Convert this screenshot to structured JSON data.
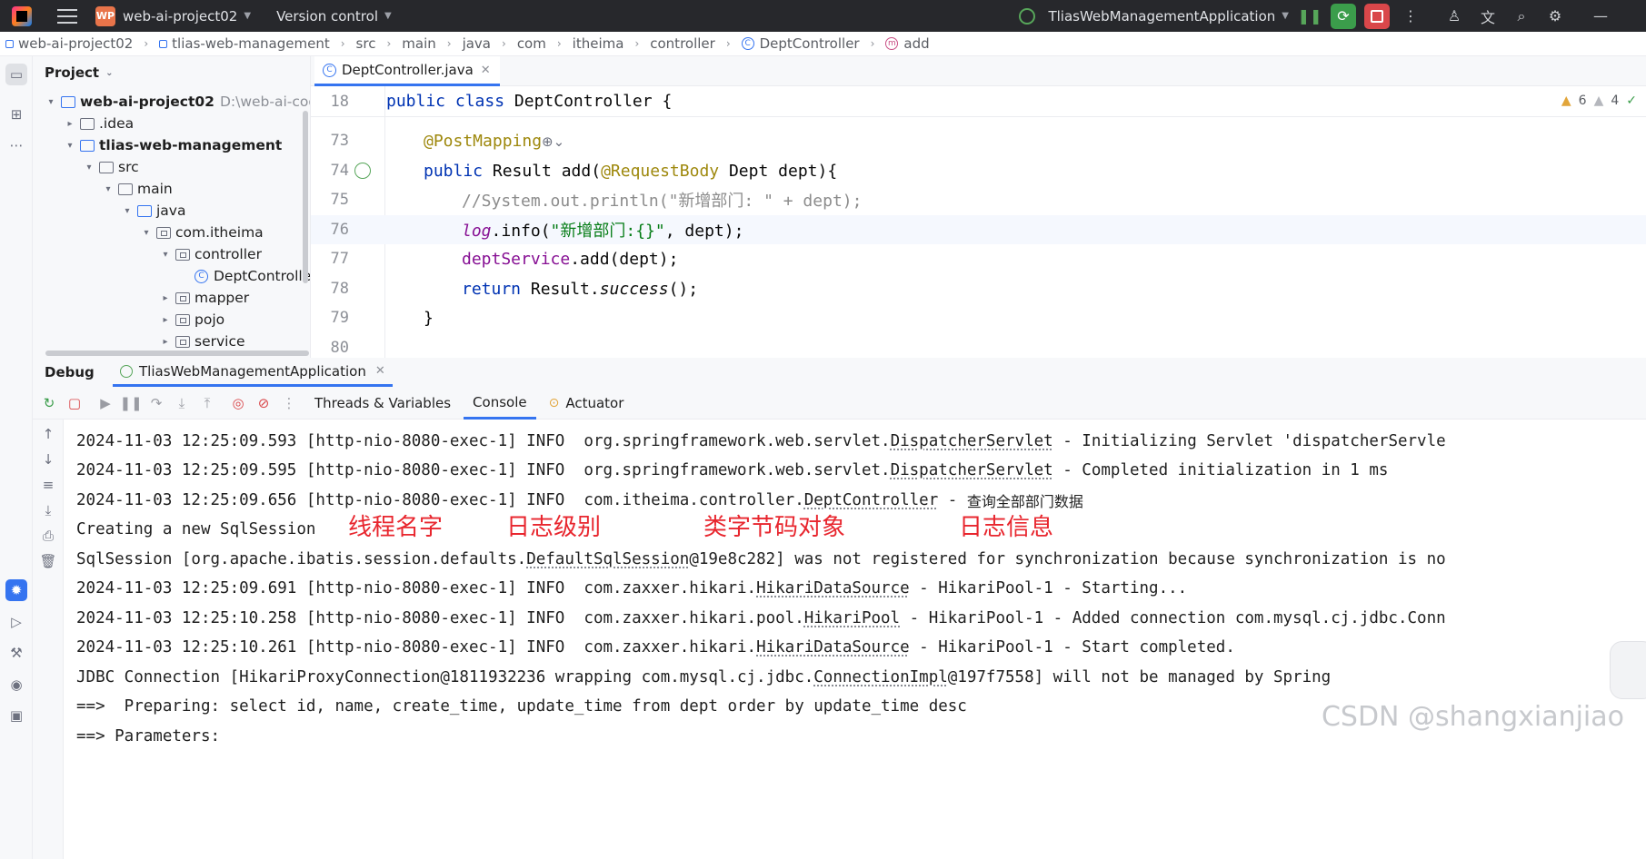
{
  "titlebar": {
    "project_badge": "WP",
    "project_name": "web-ai-project02",
    "vcs_label": "Version control",
    "run_config": "TliasWebManagementApplication"
  },
  "breadcrumb": [
    "web-ai-project02",
    "tlias-web-management",
    "src",
    "main",
    "java",
    "com",
    "itheima",
    "controller",
    "DeptController",
    "add"
  ],
  "project_panel": {
    "title": "Project",
    "tree": [
      {
        "label": "web-ai-project02",
        "path": "D:\\web-ai-code\\w"
      },
      {
        "label": ".idea"
      },
      {
        "label": "tlias-web-management"
      },
      {
        "label": "src"
      },
      {
        "label": "main"
      },
      {
        "label": "java"
      },
      {
        "label": "com.itheima"
      },
      {
        "label": "controller"
      },
      {
        "label": "DeptController"
      },
      {
        "label": "mapper"
      },
      {
        "label": "pojo"
      },
      {
        "label": "service"
      }
    ]
  },
  "editor": {
    "tab": "DeptController.java",
    "warnings": "6",
    "weak_warnings": "4",
    "lines": [
      {
        "n": "18",
        "kw": "public class ",
        "rest": "DeptController {"
      },
      {
        "n": "73",
        "ann": "@PostMapping"
      },
      {
        "n": "74",
        "kw": "public ",
        "t1": "Result ",
        "t2": "add(",
        "ann": "@RequestBody",
        "t3": " Dept dept){"
      },
      {
        "n": "75",
        "cmt": "//System.out.println(\"新增部门: \" + dept);"
      },
      {
        "n": "76",
        "fld": "log",
        "t1": ".info(",
        "str": "\"新增部门:{}\"",
        "t2": ", dept);"
      },
      {
        "n": "77",
        "fld": "deptService",
        "t1": ".add(dept);"
      },
      {
        "n": "78",
        "kw": "return ",
        "t1": "Result.",
        "it": "success",
        "t2": "();"
      },
      {
        "n": "79",
        "t1": "}"
      },
      {
        "n": "80",
        "t1": ""
      }
    ]
  },
  "debug": {
    "title": "Debug",
    "session_tab": "TliasWebManagementApplication",
    "tabs": [
      "Threads & Variables",
      "Console",
      "Actuator"
    ]
  },
  "console": {
    "lines": [
      {
        "a": "2024-11-03 12:25:09.593 [http-nio-8080-exec-1] INFO  org.springframework.web.servlet.",
        "u": "DispatcherServlet",
        "b": " - Initializing Servlet 'dispatcherServle"
      },
      {
        "a": "2024-11-03 12:25:09.595 [http-nio-8080-exec-1] INFO  org.springframework.web.servlet.",
        "u": "DispatcherServlet",
        "b": " - Completed initialization in 1 ms"
      },
      {
        "a": "2024-11-03 12:25:09.656 [http-nio-8080-exec-1] INFO  com.itheima.controller.",
        "u": "DeptController",
        "b": " - ",
        "cjk": "查询全部部门数据"
      },
      {
        "a": "Creating a new SqlSession",
        "u": "",
        "b": ""
      },
      {
        "a": "SqlSession [org.apache.ibatis.session.defaults.",
        "u": "DefaultSqlSession",
        "b": "@19e8c282] was not registered for synchronization because synchronization is no"
      },
      {
        "a": "2024-11-03 12:25:09.691 [http-nio-8080-exec-1] INFO  com.zaxxer.hikari.",
        "u": "HikariDataSource",
        "b": " - HikariPool-1 - Starting..."
      },
      {
        "a": "2024-11-03 12:25:10.258 [http-nio-8080-exec-1] INFO  com.zaxxer.hikari.pool.",
        "u": "HikariPool",
        "b": " - HikariPool-1 - Added connection com.mysql.cj.jdbc.Conn"
      },
      {
        "a": "2024-11-03 12:25:10.261 [http-nio-8080-exec-1] INFO  com.zaxxer.hikari.",
        "u": "HikariDataSource",
        "b": " - HikariPool-1 - Start completed."
      },
      {
        "a": "JDBC Connection [HikariProxyConnection@1811932236 wrapping com.mysql.cj.jdbc.",
        "u": "ConnectionImpl",
        "b": "@197f7558] will not be managed by Spring"
      },
      {
        "a": "==>  Preparing: select id, name, create_time, update_time from dept order by update_time desc",
        "u": "",
        "b": ""
      },
      {
        "a": "==> Parameters:",
        "u": "",
        "b": ""
      }
    ]
  },
  "annotations": [
    "线程名字",
    "日志级别",
    "类字节码对象",
    "日志信息"
  ],
  "watermark": "CSDN @shangxianjiao",
  "colors": {
    "accent": "#3574f0",
    "annotation": "#e8262e",
    "run": "#3b9d4b",
    "stop": "#d9474a"
  }
}
